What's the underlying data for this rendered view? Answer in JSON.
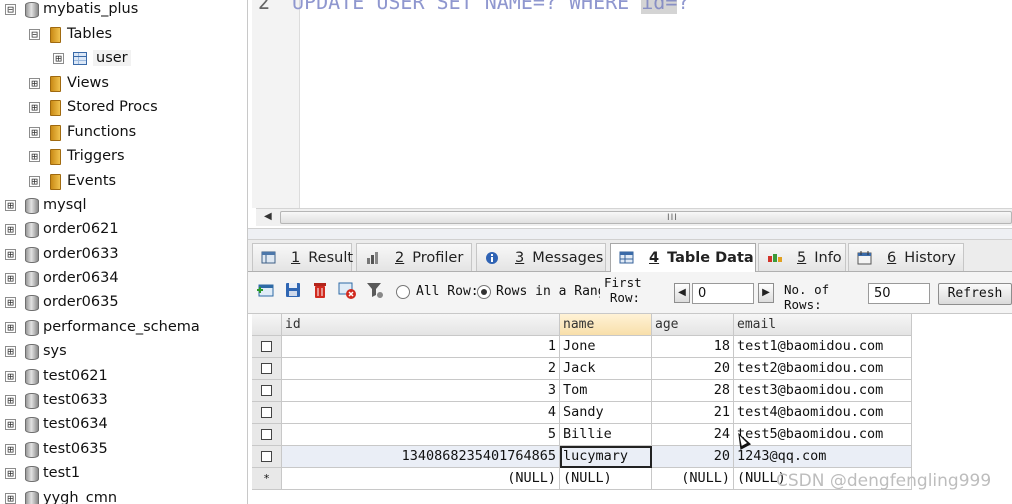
{
  "tree": {
    "root": {
      "label": "mybatis_plus",
      "expander": "⊟"
    },
    "tables": {
      "label": "Tables",
      "expander": "⊟"
    },
    "table_user": {
      "label": "user",
      "expander": "⊞"
    },
    "folders": [
      {
        "label": "Views",
        "expander": "⊞"
      },
      {
        "label": "Stored Procs",
        "expander": "⊞"
      },
      {
        "label": "Functions",
        "expander": "⊞"
      },
      {
        "label": "Triggers",
        "expander": "⊞"
      },
      {
        "label": "Events",
        "expander": "⊞"
      }
    ],
    "databases": [
      {
        "label": "mysql",
        "expander": "⊞"
      },
      {
        "label": "order0621",
        "expander": "⊞"
      },
      {
        "label": "order0633",
        "expander": "⊞"
      },
      {
        "label": "order0634",
        "expander": "⊞"
      },
      {
        "label": "order0635",
        "expander": "⊞"
      },
      {
        "label": "performance_schema",
        "expander": "⊞"
      },
      {
        "label": "sys",
        "expander": "⊞"
      },
      {
        "label": "test0621",
        "expander": "⊞"
      },
      {
        "label": "test0633",
        "expander": "⊞"
      },
      {
        "label": "test0634",
        "expander": "⊞"
      },
      {
        "label": "test0635",
        "expander": "⊞"
      },
      {
        "label": "test1",
        "expander": "⊞"
      },
      {
        "label": "yygh_cmn",
        "expander": "⊞"
      }
    ]
  },
  "editor": {
    "line_number": "2",
    "code_before": "UPDATE USER SET NAME=? WHERE ",
    "code_highlight": "id=",
    "code_after": "?",
    "scroll_grip": "III",
    "scroll_left_arrow": "◀"
  },
  "tabs": [
    {
      "num": "1",
      "label": "Result",
      "icon": "result-icon"
    },
    {
      "num": "2",
      "label": "Profiler",
      "icon": "profiler-icon"
    },
    {
      "num": "3",
      "label": "Messages",
      "icon": "messages-icon"
    },
    {
      "num": "4",
      "label": "Table Data",
      "icon": "table-data-icon",
      "active": true
    },
    {
      "num": "5",
      "label": "Info",
      "icon": "info-icon"
    },
    {
      "num": "6",
      "label": "History",
      "icon": "history-icon"
    }
  ],
  "toolbar": {
    "all_rows_label": "All Row:",
    "rows_in_range_label": "Rows in a Rang",
    "first_row_label_1": "First",
    "first_row_label_2": "Row:",
    "first_row_value": "0",
    "num_rows_label_1": "No. of",
    "num_rows_label_2": "Rows:",
    "num_rows_value": "50",
    "refresh_label": "Refresh",
    "prev_arrow": "◀",
    "next_arrow": "▶"
  },
  "grid": {
    "columns": [
      "id",
      "name",
      "age",
      "email"
    ],
    "rows": [
      {
        "id": "1",
        "name": "Jone",
        "age": "18",
        "email": "test1@baomidou.com"
      },
      {
        "id": "2",
        "name": "Jack",
        "age": "20",
        "email": "test2@baomidou.com"
      },
      {
        "id": "3",
        "name": "Tom",
        "age": "28",
        "email": "test3@baomidou.com"
      },
      {
        "id": "4",
        "name": "Sandy",
        "age": "21",
        "email": "test4@baomidou.com"
      },
      {
        "id": "5",
        "name": "Billie",
        "age": "24",
        "email": "test5@baomidou.com"
      },
      {
        "id": "1340868235401764865",
        "name": "lucymary",
        "age": "20",
        "email": "1243@qq.com"
      }
    ],
    "new_row": {
      "marker": "*",
      "id": "(NULL)",
      "name": "(NULL)",
      "age": "(NULL)",
      "email": "(NULL)"
    }
  },
  "watermark": "CSDN @dengfengling999"
}
